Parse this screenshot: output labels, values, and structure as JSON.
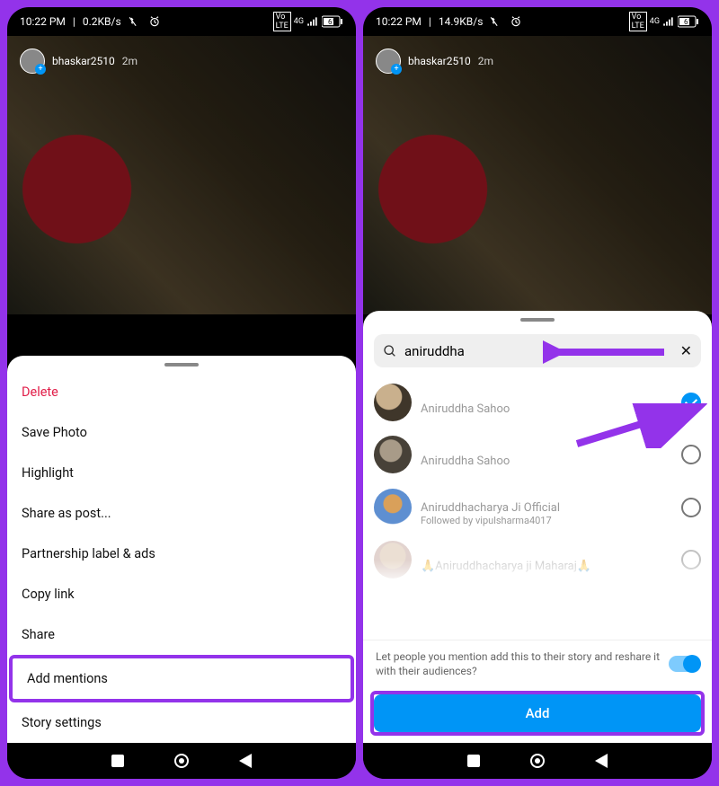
{
  "left": {
    "status": {
      "time": "10:22 PM",
      "speed": "0.2KB/s",
      "network": "VoLTE 4G",
      "battery": "61"
    },
    "story": {
      "username": "bhaskar2510",
      "age": "2m"
    },
    "menu": {
      "delete": "Delete",
      "save_photo": "Save Photo",
      "highlight": "Highlight",
      "share_as_post": "Share as post...",
      "partnership": "Partnership label & ads",
      "copy_link": "Copy link",
      "share": "Share",
      "add_mentions": "Add mentions",
      "story_settings": "Story settings"
    }
  },
  "right": {
    "status": {
      "time": "10:22 PM",
      "speed": "14.9KB/s",
      "network": "VoLTE 4G",
      "battery": "61"
    },
    "story": {
      "username": "bhaskar2510",
      "age": "2m"
    },
    "search": {
      "value": "aniruddha"
    },
    "results": [
      {
        "name": "Aniruddha Sahoo",
        "sub": "",
        "checked": true
      },
      {
        "name": "Aniruddha Sahoo",
        "sub": "",
        "checked": false
      },
      {
        "name": "Aniruddhacharya Ji Official",
        "sub": "Followed by vipulsharma4017",
        "checked": false
      },
      {
        "name": "🙏Aniruddhacharya ji Maharaj🙏",
        "sub": "",
        "checked": false,
        "faded": true
      }
    ],
    "toggle_label": "Let people you mention add this to their story and reshare it with their audiences?",
    "add_button": "Add"
  }
}
